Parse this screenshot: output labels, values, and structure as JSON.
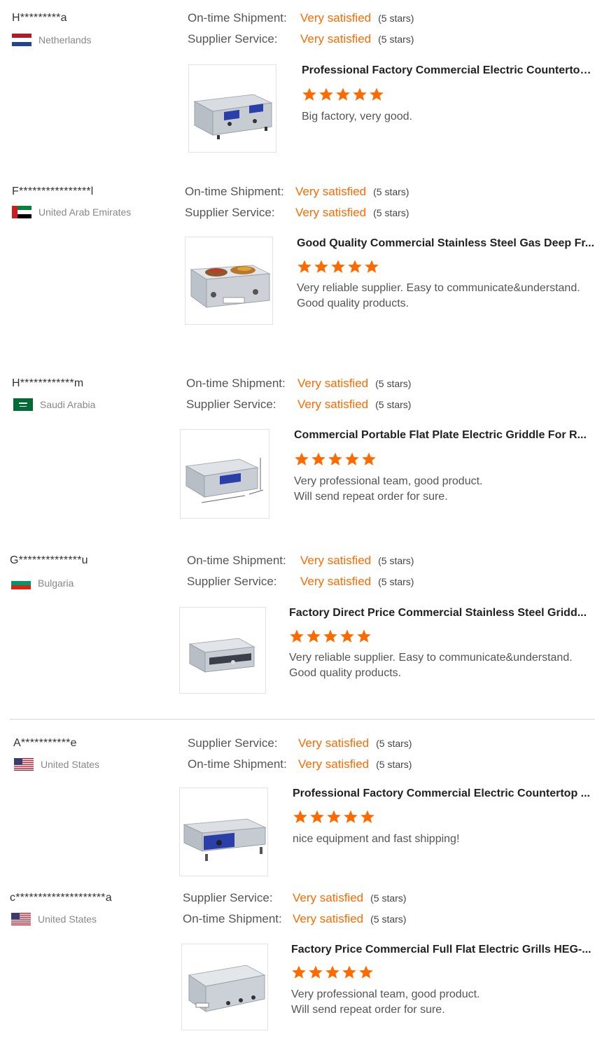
{
  "labels": {
    "ontime": "On-time Shipment:",
    "service": "Supplier Service:"
  },
  "reviews": [
    {
      "buyer": "H*********a",
      "country": "Netherlands",
      "flag": "netherlands",
      "line1": {
        "label": "On-time Shipment:",
        "value": "Very satisfied",
        "stars": "(5 stars)"
      },
      "line2": {
        "label": "Supplier Service:",
        "value": "Very satisfied",
        "stars": "(5 stars)"
      },
      "product": "Professional Factory Commercial Electric Countertop ...",
      "rating": 5,
      "comment": "Big factory, very good."
    },
    {
      "buyer": "F****************l",
      "country": "United Arab Emirates",
      "flag": "uae",
      "line1": {
        "label": "On-time Shipment:",
        "value": "Very satisfied",
        "stars": "(5 stars)"
      },
      "line2": {
        "label": "Supplier Service:",
        "value": "Very satisfied",
        "stars": "(5 stars)"
      },
      "product": "Good Quality Commercial Stainless Steel Gas Deep Fr...",
      "rating": 5,
      "comment": "Very reliable supplier. Easy to communicate&understand.\nGood quality products."
    },
    {
      "buyer": "H************m",
      "country": "Saudi Arabia",
      "flag": "saudi",
      "line1": {
        "label": "On-time Shipment:",
        "value": "Very satisfied",
        "stars": "(5 stars)"
      },
      "line2": {
        "label": "Supplier Service:",
        "value": "Very satisfied",
        "stars": "(5 stars)"
      },
      "product": "Commercial Portable Flat Plate Electric Griddle For R...",
      "rating": 5,
      "comment": "Very professional team, good product.\nWill send repeat order for sure."
    },
    {
      "buyer": "G**************u",
      "country": "Bulgaria",
      "flag": "bulgaria",
      "line1": {
        "label": "On-time Shipment:",
        "value": "Very satisfied",
        "stars": "(5 stars)"
      },
      "line2": {
        "label": "Supplier Service:",
        "value": "Very satisfied",
        "stars": "(5 stars)"
      },
      "product": "Factory Direct Price Commercial Stainless Steel Gridd...",
      "rating": 5,
      "comment": "Very reliable supplier. Easy to communicate&understand.\nGood quality products."
    },
    {
      "buyer": "A***********e",
      "country": "United States",
      "flag": "usa",
      "line1": {
        "label": "Supplier Service:",
        "value": "Very satisfied",
        "stars": "(5 stars)"
      },
      "line2": {
        "label": "On-time Shipment:",
        "value": "Very satisfied",
        "stars": "(5 stars)"
      },
      "product": "Professional Factory Commercial Electric Countertop ...",
      "rating": 5,
      "comment": "nice equipment and fast shipping!"
    },
    {
      "buyer": "c********************a",
      "country": "United States",
      "flag": "usa",
      "line1": {
        "label": "Supplier Service:",
        "value": "Very satisfied",
        "stars": "(5 stars)"
      },
      "line2": {
        "label": "On-time Shipment:",
        "value": "Very satisfied",
        "stars": "(5 stars)"
      },
      "product": "Factory Price Commercial Full Flat Electric Grills HEG-...",
      "rating": 5,
      "comment": "Very professional team, good product.\nWill send repeat order for sure."
    }
  ],
  "colors": {
    "accent": "#ff6a00",
    "label": "#555555",
    "muted": "#888888"
  }
}
